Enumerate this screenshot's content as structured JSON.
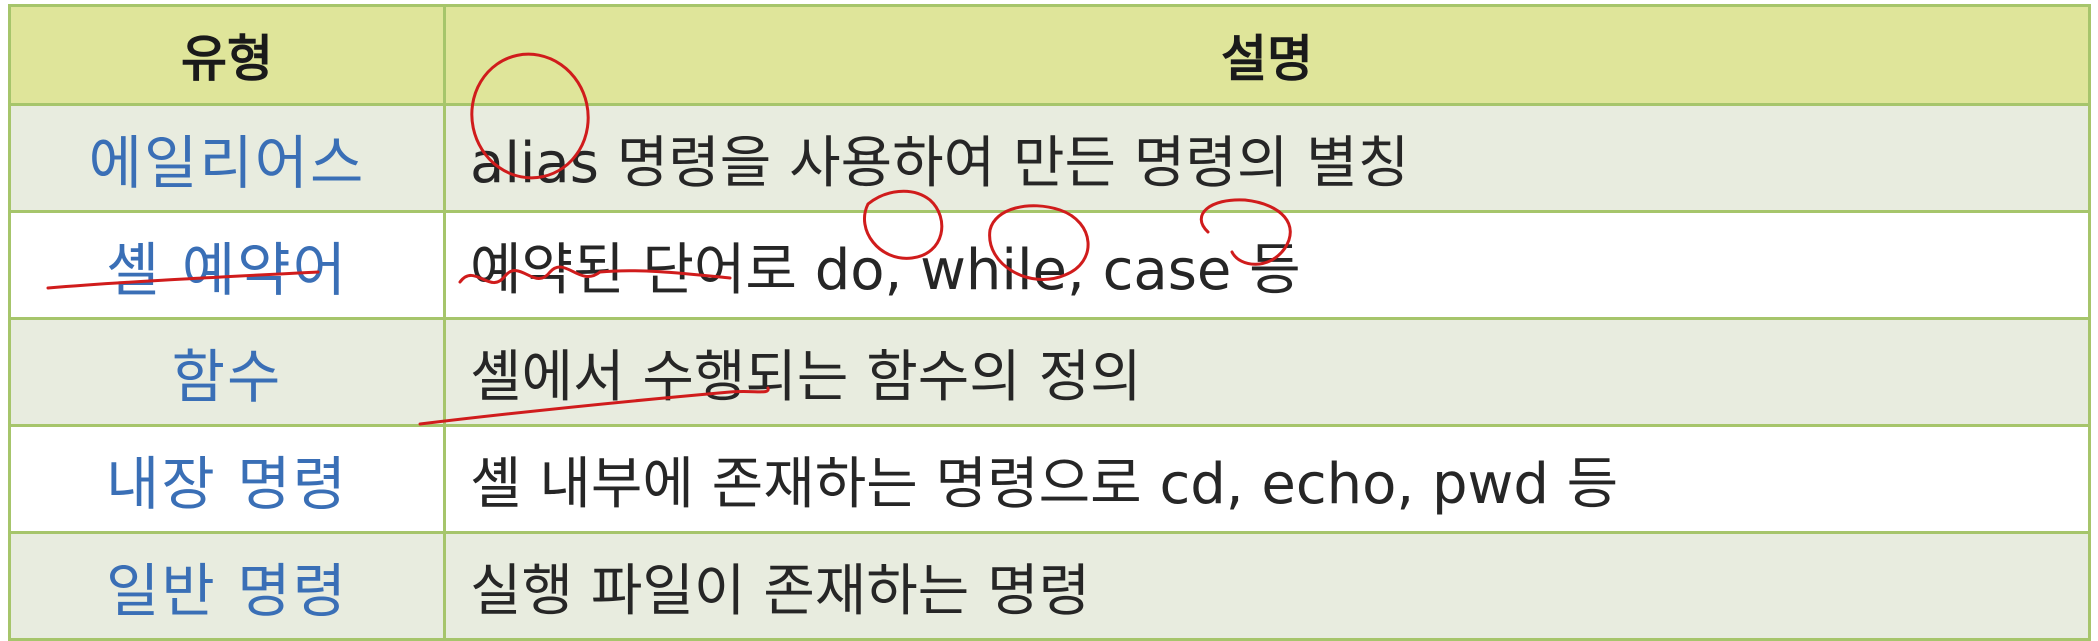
{
  "headers": {
    "type": "유형",
    "description": "설명"
  },
  "rows": [
    {
      "type": "에일리어스",
      "description": "alias 명령을 사용하여 만든 명령의 별칭"
    },
    {
      "type": "셸 예약어",
      "description": "예약된 단어로 do, while, case 등"
    },
    {
      "type": "함수",
      "description": "셸에서 수행되는 함수의 정의"
    },
    {
      "type": "내장 명령",
      "description": "셸 내부에 존재하는 명령으로 cd, echo, pwd 등"
    },
    {
      "type": "일반 명령",
      "description": "실행 파일이 존재하는 명령"
    }
  ],
  "colors": {
    "header_bg": "#dfe59a",
    "border": "#a6c56b",
    "type_text": "#3a6fb6",
    "shaded_row": "#e8ecdf",
    "annotation": "#d01c1c"
  }
}
